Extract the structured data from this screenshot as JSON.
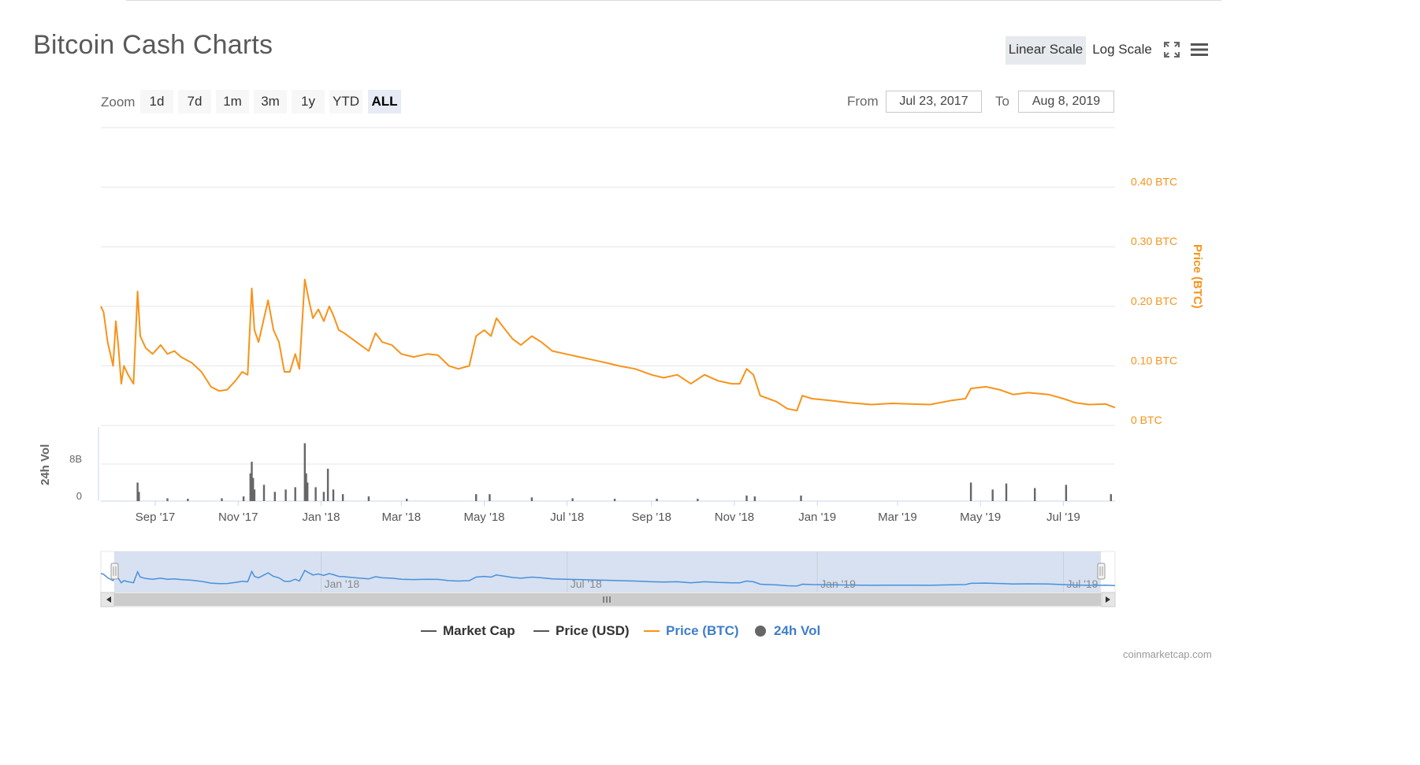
{
  "page": {
    "title": "Bitcoin Cash Charts",
    "credit": "coinmarketcap.com"
  },
  "toolbar": {
    "linear_label": "Linear Scale",
    "log_label": "Log Scale",
    "fullscreen_icon": "fullscreen-icon",
    "menu_icon": "menu-icon"
  },
  "zoom": {
    "label": "Zoom",
    "buttons": [
      "1d",
      "7d",
      "1m",
      "3m",
      "1y",
      "YTD",
      "ALL"
    ],
    "active": "ALL"
  },
  "range": {
    "from_label": "From",
    "from_value": "Jul 23, 2017",
    "to_label": "To",
    "to_value": "Aug 8, 2019"
  },
  "legend": [
    {
      "name": "Market Cap",
      "color": "#555555",
      "kind": "line"
    },
    {
      "name": "Price (USD)",
      "color": "#555555",
      "kind": "line"
    },
    {
      "name": "Price (BTC)",
      "color": "#f7931a",
      "kind": "line",
      "text_color": "#3f7ec9"
    },
    {
      "name": "24h Vol",
      "color": "#666666",
      "kind": "dot",
      "text_color": "#3f7ec9"
    }
  ],
  "colors": {
    "price_btc": "#f7931a",
    "volume": "#666666",
    "navigator_line": "#4a90d9",
    "navigator_fill": "#d3deef",
    "grid": "#e6e6e6"
  },
  "chart_data": {
    "type": "line",
    "x_range": [
      "2017-07-23",
      "2019-08-08"
    ],
    "x_ticks": [
      "Sep '17",
      "Nov '17",
      "Jan '18",
      "Mar '18",
      "May '18",
      "Jul '18",
      "Sep '18",
      "Nov '18",
      "Jan '19",
      "Mar '19",
      "May '19",
      "Jul '19"
    ],
    "price_axis": {
      "label": "Price (BTC)",
      "ticks": [
        "0 BTC",
        "0.10 BTC",
        "0.20 BTC",
        "0.30 BTC",
        "0.40 BTC"
      ],
      "ylim": [
        0,
        0.5
      ]
    },
    "volume_axis": {
      "label": "24h Vol",
      "ticks": [
        "0",
        "8B"
      ],
      "ylim": [
        0,
        16
      ]
    },
    "navigator_ticks": [
      "Jan '18",
      "Jul '18",
      "Jan '19",
      "Jul '19"
    ],
    "series": [
      {
        "name": "Price (BTC)",
        "points": [
          [
            "2017-07-23",
            0.2
          ],
          [
            "2017-07-25",
            0.19
          ],
          [
            "2017-07-28",
            0.14
          ],
          [
            "2017-08-01",
            0.1
          ],
          [
            "2017-08-03",
            0.175
          ],
          [
            "2017-08-05",
            0.13
          ],
          [
            "2017-08-07",
            0.07
          ],
          [
            "2017-08-09",
            0.1
          ],
          [
            "2017-08-12",
            0.085
          ],
          [
            "2017-08-16",
            0.07
          ],
          [
            "2017-08-19",
            0.225
          ],
          [
            "2017-08-21",
            0.15
          ],
          [
            "2017-08-25",
            0.13
          ],
          [
            "2017-08-30",
            0.12
          ],
          [
            "2017-09-05",
            0.135
          ],
          [
            "2017-09-10",
            0.12
          ],
          [
            "2017-09-15",
            0.125
          ],
          [
            "2017-09-20",
            0.115
          ],
          [
            "2017-09-28",
            0.105
          ],
          [
            "2017-10-05",
            0.09
          ],
          [
            "2017-10-12",
            0.065
          ],
          [
            "2017-10-18",
            0.058
          ],
          [
            "2017-10-24",
            0.06
          ],
          [
            "2017-10-30",
            0.075
          ],
          [
            "2017-11-04",
            0.09
          ],
          [
            "2017-11-08",
            0.085
          ],
          [
            "2017-11-11",
            0.23
          ],
          [
            "2017-11-13",
            0.16
          ],
          [
            "2017-11-16",
            0.14
          ],
          [
            "2017-11-19",
            0.17
          ],
          [
            "2017-11-23",
            0.21
          ],
          [
            "2017-11-27",
            0.16
          ],
          [
            "2017-12-01",
            0.14
          ],
          [
            "2017-12-05",
            0.09
          ],
          [
            "2017-12-09",
            0.09
          ],
          [
            "2017-12-13",
            0.12
          ],
          [
            "2017-12-16",
            0.095
          ],
          [
            "2017-12-20",
            0.245
          ],
          [
            "2017-12-23",
            0.21
          ],
          [
            "2017-12-26",
            0.18
          ],
          [
            "2017-12-30",
            0.195
          ],
          [
            "2018-01-03",
            0.175
          ],
          [
            "2018-01-07",
            0.2
          ],
          [
            "2018-01-10",
            0.185
          ],
          [
            "2018-01-14",
            0.16
          ],
          [
            "2018-01-18",
            0.155
          ],
          [
            "2018-01-24",
            0.145
          ],
          [
            "2018-01-30",
            0.135
          ],
          [
            "2018-02-05",
            0.125
          ],
          [
            "2018-02-10",
            0.155
          ],
          [
            "2018-02-15",
            0.14
          ],
          [
            "2018-02-22",
            0.135
          ],
          [
            "2018-03-01",
            0.12
          ],
          [
            "2018-03-10",
            0.115
          ],
          [
            "2018-03-20",
            0.12
          ],
          [
            "2018-03-28",
            0.118
          ],
          [
            "2018-04-05",
            0.1
          ],
          [
            "2018-04-12",
            0.095
          ],
          [
            "2018-04-20",
            0.1
          ],
          [
            "2018-04-25",
            0.15
          ],
          [
            "2018-05-01",
            0.16
          ],
          [
            "2018-05-06",
            0.15
          ],
          [
            "2018-05-10",
            0.18
          ],
          [
            "2018-05-15",
            0.165
          ],
          [
            "2018-05-22",
            0.145
          ],
          [
            "2018-05-28",
            0.135
          ],
          [
            "2018-06-05",
            0.15
          ],
          [
            "2018-06-12",
            0.14
          ],
          [
            "2018-06-20",
            0.125
          ],
          [
            "2018-06-30",
            0.12
          ],
          [
            "2018-07-10",
            0.115
          ],
          [
            "2018-07-20",
            0.11
          ],
          [
            "2018-07-30",
            0.105
          ],
          [
            "2018-08-08",
            0.1
          ],
          [
            "2018-08-20",
            0.095
          ],
          [
            "2018-09-01",
            0.085
          ],
          [
            "2018-09-10",
            0.08
          ],
          [
            "2018-09-20",
            0.085
          ],
          [
            "2018-09-30",
            0.07
          ],
          [
            "2018-10-10",
            0.085
          ],
          [
            "2018-10-20",
            0.075
          ],
          [
            "2018-10-30",
            0.07
          ],
          [
            "2018-11-05",
            0.07
          ],
          [
            "2018-11-10",
            0.095
          ],
          [
            "2018-11-15",
            0.085
          ],
          [
            "2018-11-20",
            0.05
          ],
          [
            "2018-11-26",
            0.045
          ],
          [
            "2018-12-02",
            0.04
          ],
          [
            "2018-12-10",
            0.028
          ],
          [
            "2018-12-17",
            0.025
          ],
          [
            "2018-12-21",
            0.05
          ],
          [
            "2018-12-28",
            0.045
          ],
          [
            "2019-01-10",
            0.042
          ],
          [
            "2019-01-25",
            0.038
          ],
          [
            "2019-02-10",
            0.035
          ],
          [
            "2019-02-25",
            0.037
          ],
          [
            "2019-03-10",
            0.036
          ],
          [
            "2019-03-25",
            0.035
          ],
          [
            "2019-04-10",
            0.042
          ],
          [
            "2019-04-20",
            0.045
          ],
          [
            "2019-04-24",
            0.062
          ],
          [
            "2019-05-05",
            0.065
          ],
          [
            "2019-05-15",
            0.06
          ],
          [
            "2019-05-25",
            0.052
          ],
          [
            "2019-06-05",
            0.055
          ],
          [
            "2019-06-20",
            0.052
          ],
          [
            "2019-07-01",
            0.045
          ],
          [
            "2019-07-10",
            0.038
          ],
          [
            "2019-07-20",
            0.035
          ],
          [
            "2019-08-01",
            0.036
          ],
          [
            "2019-08-08",
            0.03
          ]
        ]
      },
      {
        "name": "24h Vol",
        "unit": "B",
        "points": [
          [
            "2017-08-19",
            4.0
          ],
          [
            "2017-08-20",
            2.0
          ],
          [
            "2017-09-10",
            0.6
          ],
          [
            "2017-09-25",
            0.5
          ],
          [
            "2017-10-20",
            0.6
          ],
          [
            "2017-11-05",
            1.0
          ],
          [
            "2017-11-10",
            6.0
          ],
          [
            "2017-11-11",
            8.5
          ],
          [
            "2017-11-12",
            5.0
          ],
          [
            "2017-11-13",
            2.5
          ],
          [
            "2017-11-20",
            3.5
          ],
          [
            "2017-11-28",
            2.0
          ],
          [
            "2017-12-06",
            2.5
          ],
          [
            "2017-12-13",
            3.0
          ],
          [
            "2017-12-20",
            12.5
          ],
          [
            "2017-12-21",
            6.0
          ],
          [
            "2017-12-22",
            4.0
          ],
          [
            "2017-12-28",
            3.0
          ],
          [
            "2018-01-03",
            2.0
          ],
          [
            "2018-01-06",
            7.0
          ],
          [
            "2018-01-10",
            2.5
          ],
          [
            "2018-01-17",
            1.5
          ],
          [
            "2018-02-05",
            1.0
          ],
          [
            "2018-03-05",
            0.5
          ],
          [
            "2018-04-25",
            1.5
          ],
          [
            "2018-05-05",
            1.5
          ],
          [
            "2018-06-05",
            0.8
          ],
          [
            "2018-07-05",
            0.6
          ],
          [
            "2018-08-05",
            0.5
          ],
          [
            "2018-09-05",
            0.5
          ],
          [
            "2018-10-05",
            0.5
          ],
          [
            "2018-11-10",
            1.2
          ],
          [
            "2018-11-16",
            1.0
          ],
          [
            "2018-12-20",
            1.2
          ],
          [
            "2019-04-24",
            4.0
          ],
          [
            "2019-05-10",
            2.5
          ],
          [
            "2019-05-20",
            3.8
          ],
          [
            "2019-06-10",
            2.8
          ],
          [
            "2019-07-03",
            3.5
          ],
          [
            "2019-08-05",
            1.5
          ]
        ]
      }
    ]
  }
}
